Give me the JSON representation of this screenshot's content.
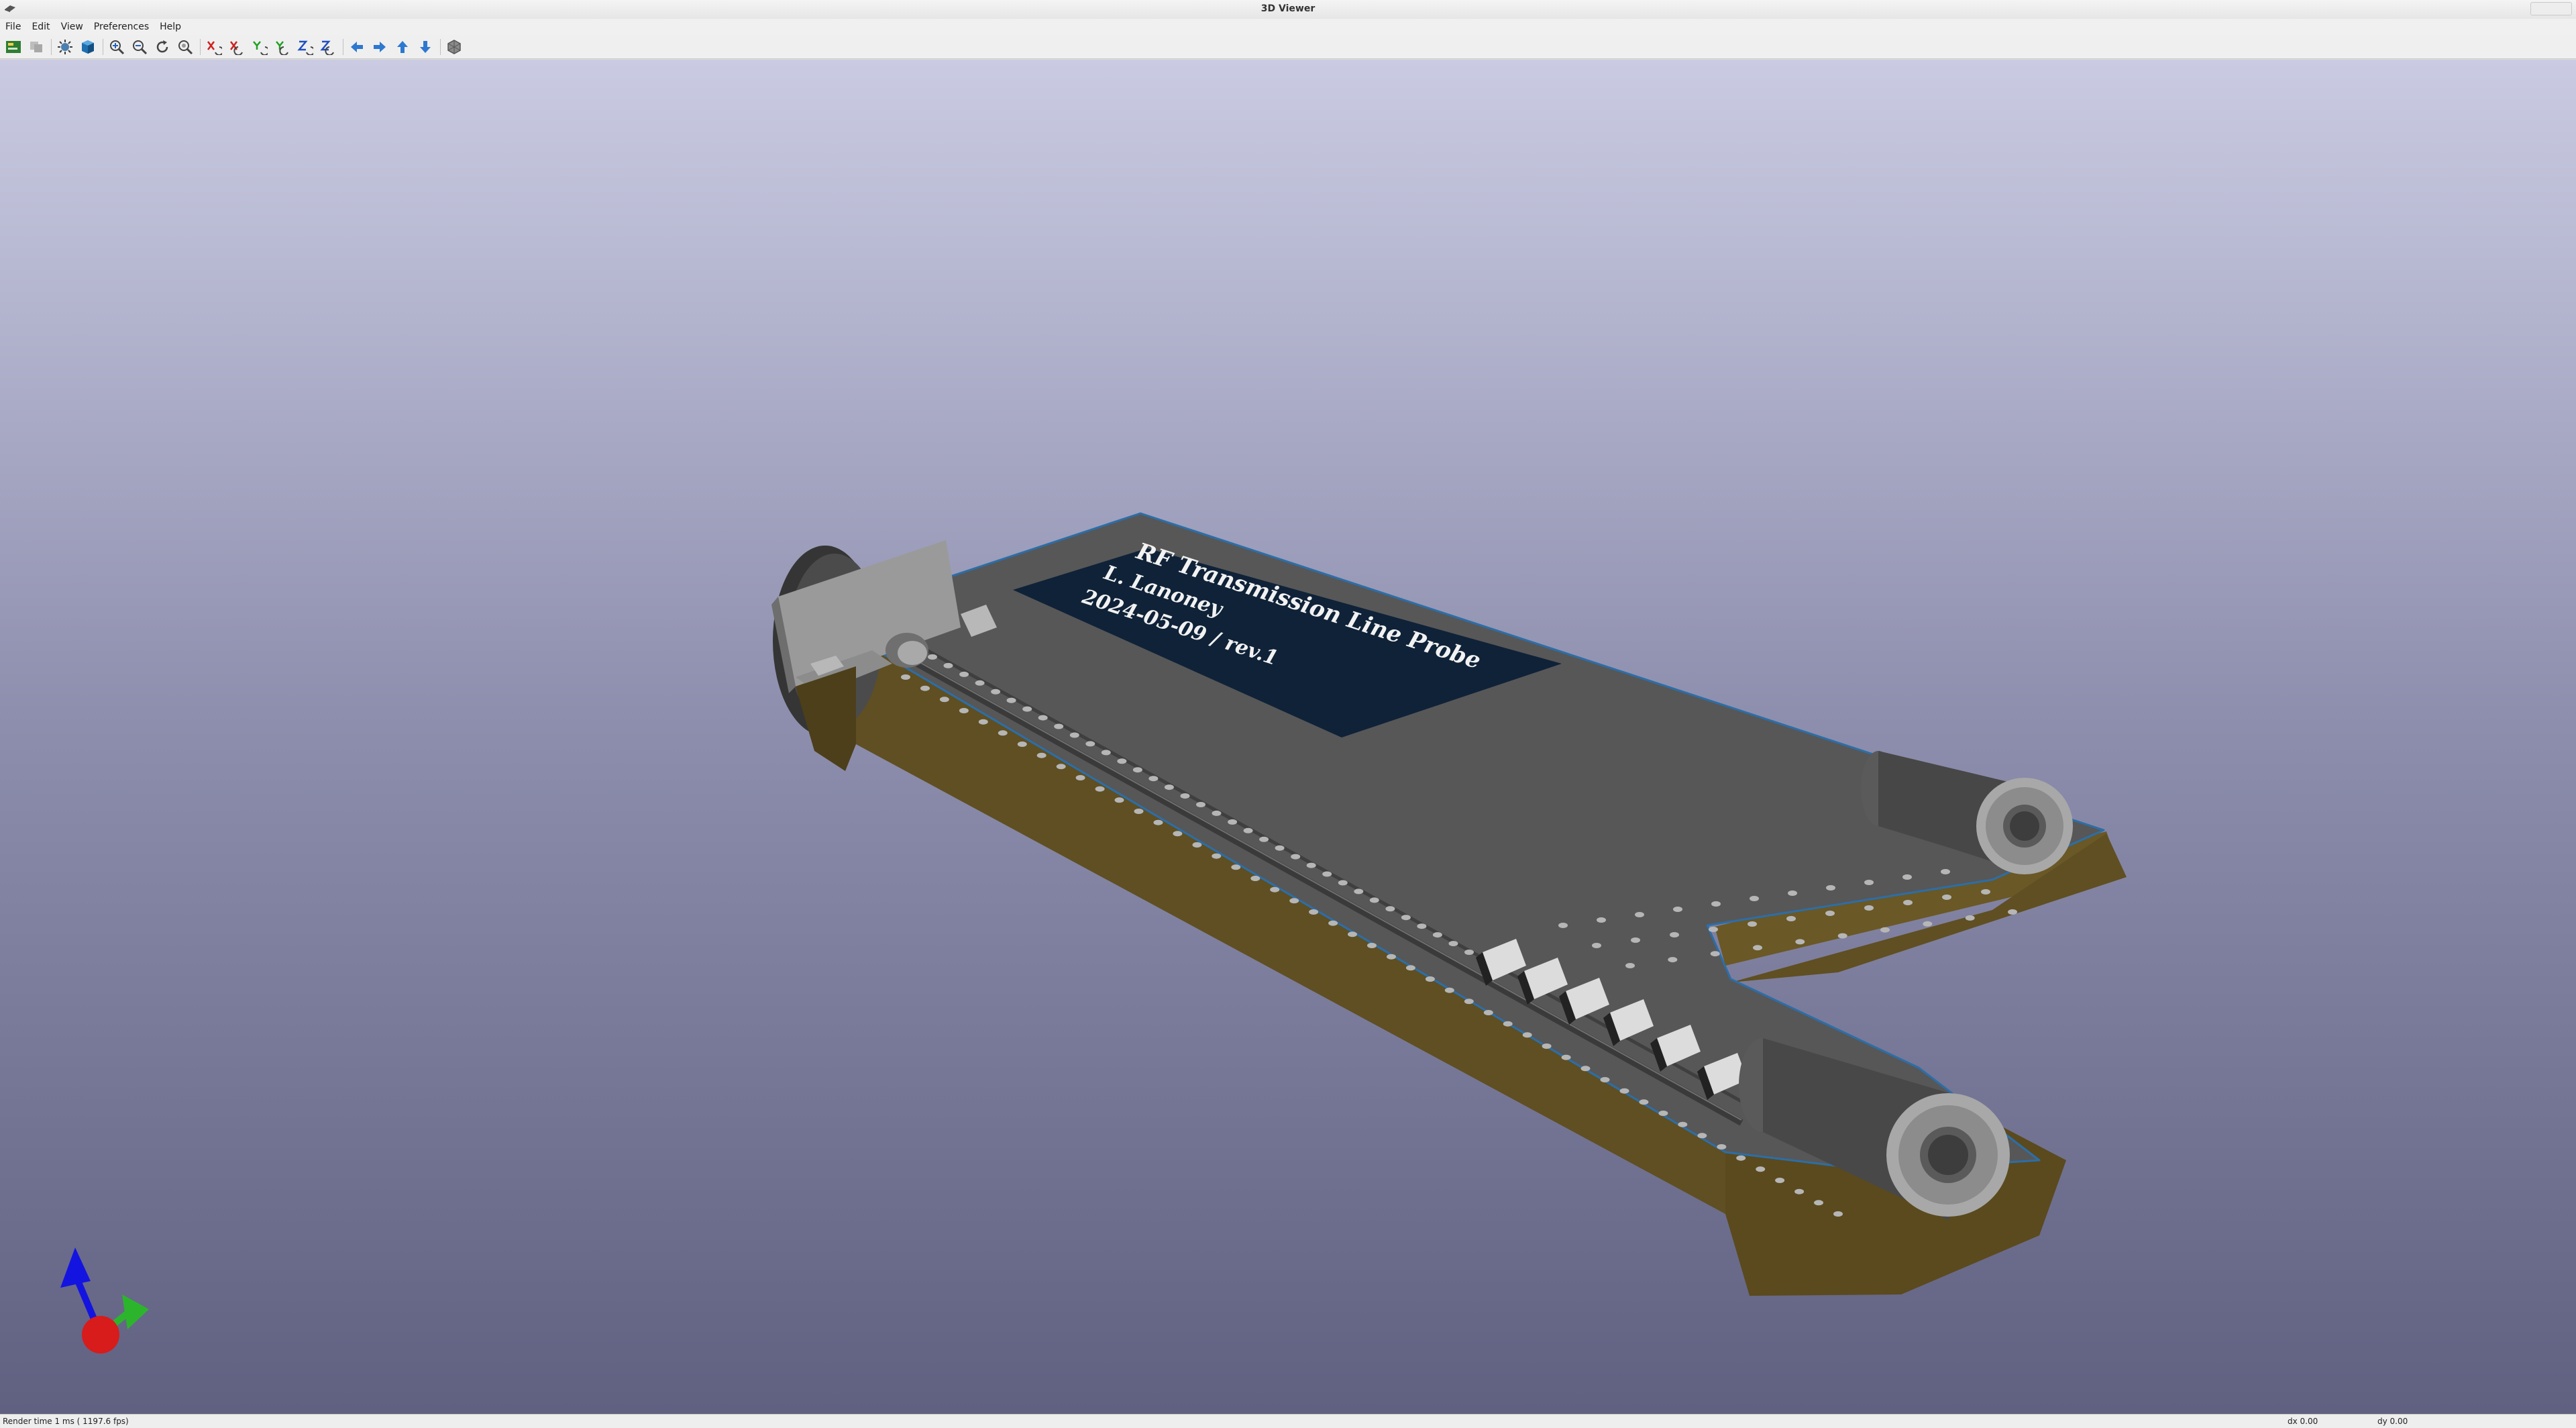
{
  "window": {
    "title": "3D Viewer"
  },
  "menu": [
    "File",
    "Edit",
    "View",
    "Preferences",
    "Help"
  ],
  "toolbar": {
    "buttons": [
      "reload-board-icon",
      "copy-image-icon",
      "raytracing-icon",
      "render-mode-icon",
      "zoom-in-icon",
      "zoom-out-icon",
      "redraw-icon",
      "zoom-fit-icon",
      "rotate-x-cw-icon",
      "rotate-x-ccw-icon",
      "rotate-y-cw-icon",
      "rotate-y-ccw-icon",
      "rotate-z-cw-icon",
      "rotate-z-ccw-icon",
      "pan-left-icon",
      "pan-right-icon",
      "pan-up-icon",
      "pan-down-icon",
      "orthographic-icon"
    ]
  },
  "board": {
    "silkscreen": [
      "RF Transmission Line Probe",
      "L. Lanoney",
      "2024-05-09 / rev.1"
    ],
    "colors": {
      "top": "#575757",
      "side": "#5f4f22",
      "solder_mask": "#0f2238",
      "silkscreen": "#f2f2f2",
      "edge": "#2c6ea8"
    }
  },
  "axis_colors": {
    "x": "#d81b1b",
    "y": "#2cb52c",
    "z": "#1414e0"
  },
  "status": {
    "render_time": "Render time 1 ms ( 1197.6 fps)",
    "dx": "dx 0.00",
    "dy": "dy 0.00"
  }
}
